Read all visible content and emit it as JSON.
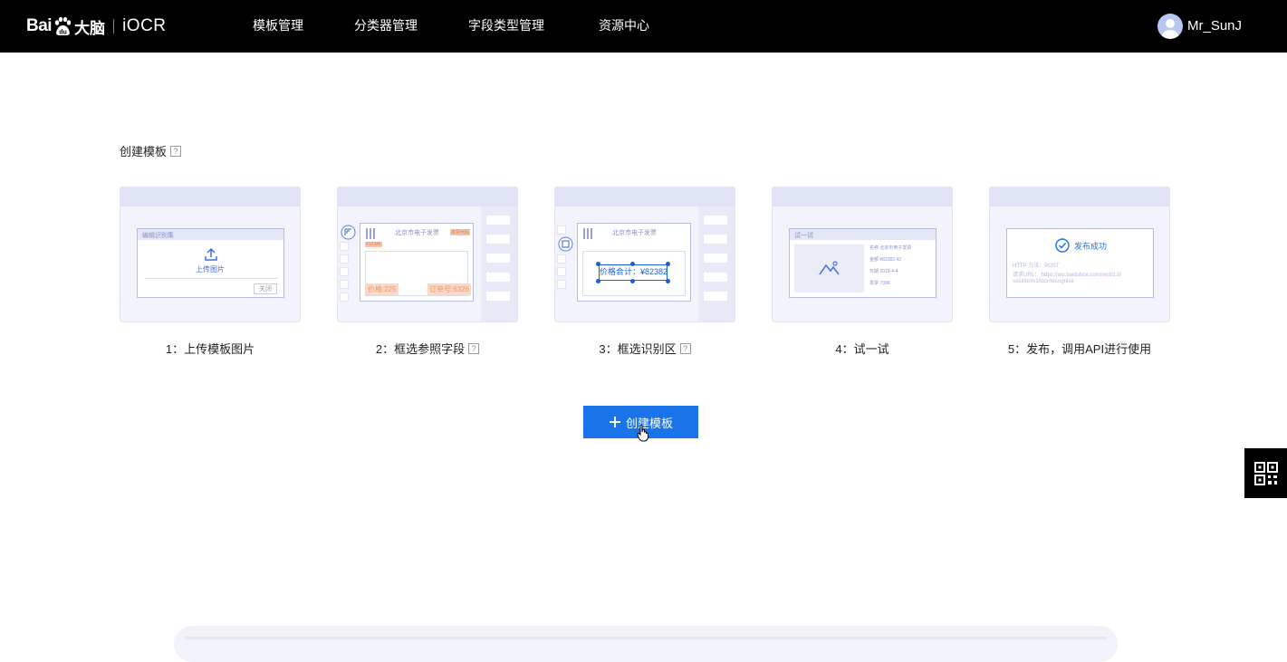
{
  "header": {
    "logo_bai": "Bai",
    "logo_du": "du",
    "logo_daonao": "大脑",
    "logo_product": "iOCR",
    "nav": [
      {
        "label": "模板管理"
      },
      {
        "label": "分类器管理"
      },
      {
        "label": "字段类型管理"
      },
      {
        "label": "资源中心"
      }
    ],
    "user_name": "Mr_SunJ"
  },
  "main": {
    "section_title": "创建模板",
    "help_mark": "?",
    "steps": [
      {
        "label": "1：上传模板图片",
        "has_help": false,
        "preview": {
          "dialog_title": "编辑识别集",
          "upload_text": "上传图片",
          "close_text": "关闭"
        }
      },
      {
        "label": "2：框选参照字段",
        "has_help": true,
        "preview": {
          "doc_title": "北京市电子发票",
          "tag_left": "¥12345",
          "tag_right": "发票代码",
          "field_price": "价格:225",
          "field_order": "订单号:6326"
        }
      },
      {
        "label": "3：框选识别区",
        "has_help": true,
        "preview": {
          "doc_title": "北京市电子发票",
          "box_text": "价格合计：¥82382"
        }
      },
      {
        "label": "4：试一试",
        "has_help": false,
        "preview": {
          "panel_title": "试一试",
          "rows": [
            "名称 北京市电子发票",
            "金额 ¥82382.42",
            "日期 2019-4-4",
            "发票 7396"
          ]
        }
      },
      {
        "label": "5：发布，调用API进行使用",
        "has_help": false,
        "preview": {
          "success_text": "发布成功",
          "line1": "HTTP 方法：POST",
          "line2": "请求URL：  https://aip.baidubce.com/rest/2.0/",
          "line3": "solution/v1/iocr/recognise"
        }
      }
    ],
    "create_button_label": "创建模板"
  },
  "colors": {
    "topbar": "#000000",
    "accent": "#1a73e8",
    "card_bg": "#f3f4fb",
    "card_bar": "#e1e4f6",
    "highlight": "#f6c7ac"
  },
  "icons": {
    "create_button": "plus-icon",
    "float_widget": "qr-code-icon",
    "publish_success": "check-circle-icon",
    "upload": "upload-icon",
    "test_image": "image-icon"
  }
}
